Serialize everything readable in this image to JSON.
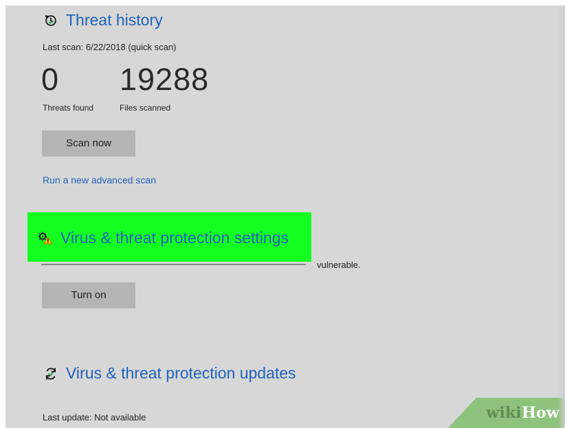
{
  "threat_history": {
    "title": "Threat history",
    "last_scan": "Last scan: 6/22/2018 (quick scan)",
    "threats_found_value": "0",
    "files_scanned_value": "19288",
    "threats_found_label": "Threats found",
    "files_scanned_label": "Files scanned",
    "scan_button": "Scan now",
    "advanced_scan_link": "Run a new advanced scan",
    "icon": "history-icon"
  },
  "virus_settings": {
    "title": "Virus & threat protection settings",
    "warning": "vulnerable.",
    "turn_on_button": "Turn on",
    "icon": "gear-warning-icon"
  },
  "virus_updates": {
    "title": "Virus & threat protection updates",
    "last_update": "Last update: Not available",
    "icon": "refresh-icon"
  },
  "watermark": {
    "wiki": "wiki",
    "how": "How"
  },
  "colors": {
    "background": "#d7d7d7",
    "link": "#1f62ba",
    "highlight": "#13ff20",
    "button": "#b5b5b5",
    "watermark_green": "#8ec37d"
  }
}
